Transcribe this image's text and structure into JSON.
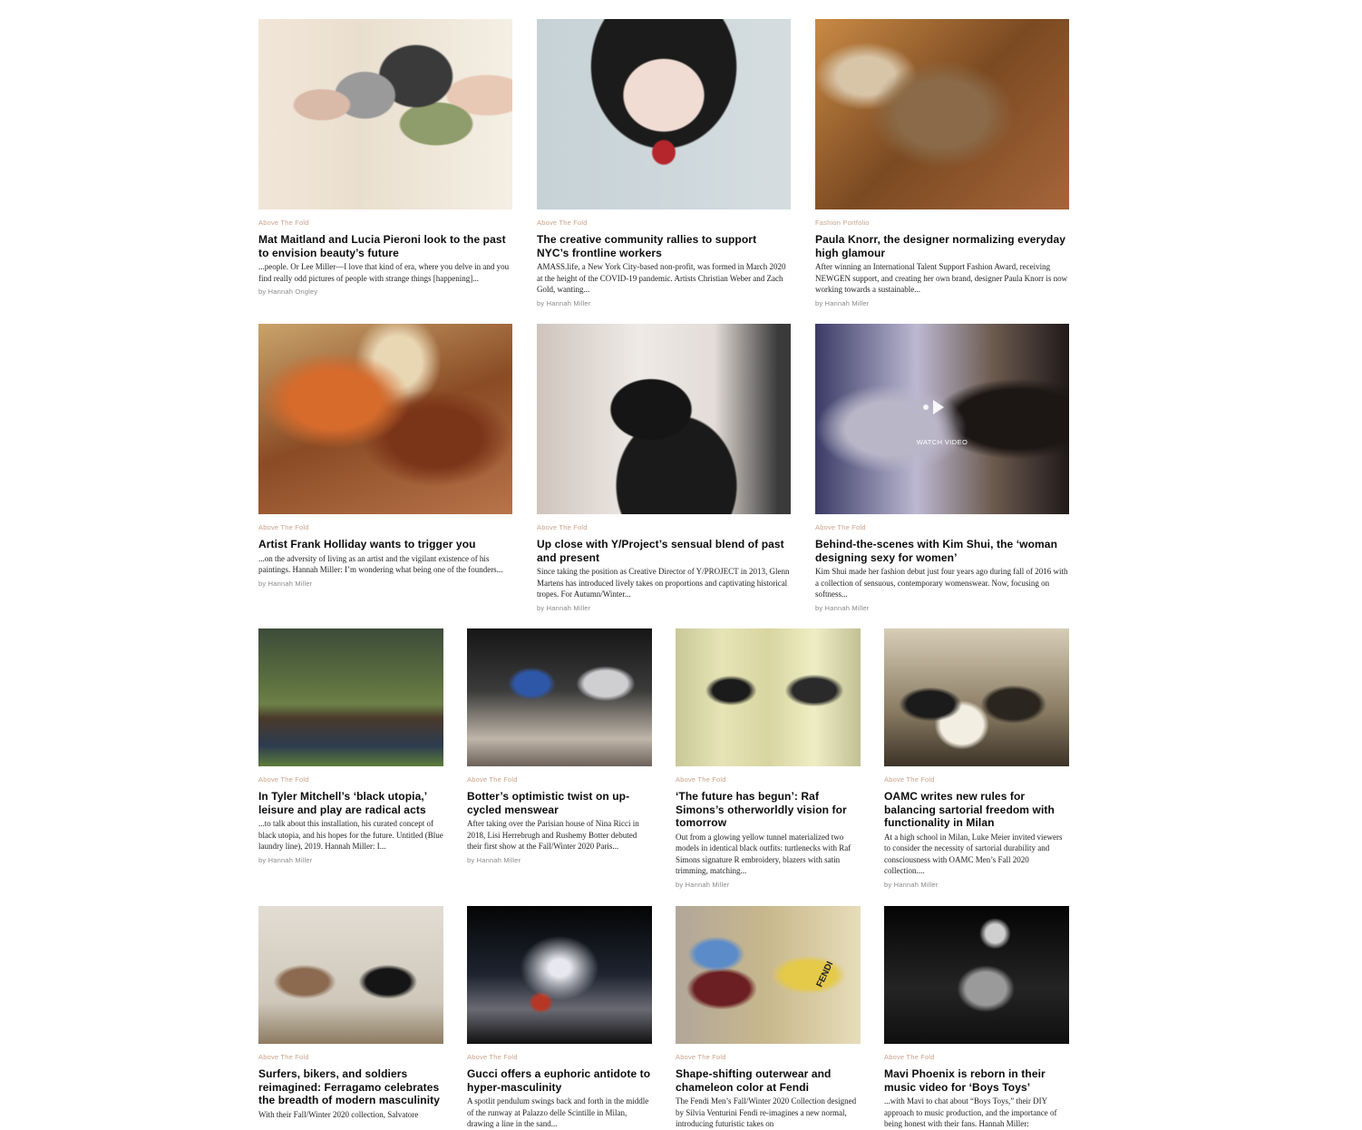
{
  "articles": [
    {
      "category": "Above The Fold",
      "title": "Mat Maitland and Lucia Pieroni look to the past to envision beauty’s future",
      "excerpt": "...people. Or Lee Miller—I love that kind of era, where you delve in and you find really odd pictures of people with strange things [happening]...",
      "author": "by Hannah Ongley"
    },
    {
      "category": "Above The Fold",
      "title": "The creative community rallies to support NYC’s frontline workers",
      "excerpt": "AMASS.life, a New York City-based non-profit, was formed in March 2020 at the height of the COVID-19 pandemic. Artists Christian Weber and Zach Gold, wanting...",
      "author": "by Hannah Miller"
    },
    {
      "category": "Fashion Portfolio",
      "title": "Paula Knorr, the designer normalizing everyday high glamour",
      "excerpt": "After winning an International Talent Support Fashion Award, receiving NEWGEN support, and creating her own brand, designer Paula Knorr is now working towards a sustainable...",
      "author": "by Hannah Miller"
    },
    {
      "category": "Above The Fold",
      "title": "Artist Frank Holliday wants to trigger you",
      "excerpt": "...on the adversity of living as an artist and the vigilant existence of his paintings. Hannah Miller: I’m wondering what being one of the founders...",
      "author": "by Hannah Miller"
    },
    {
      "category": "Above The Fold",
      "title": "Up close with Y/Project’s sensual blend of past and present",
      "excerpt": "Since taking the position as Creative Director of Y/PROJECT in 2013, Glenn Martens has introduced lively takes on proportions and captivating historical tropes. For Autumn/Winter...",
      "author": "by Hannah Miller"
    },
    {
      "category": "Above The Fold",
      "title": "Behind-the-scenes with Kim Shui, the ‘woman designing sexy for women’",
      "excerpt": "Kim Shui made her fashion debut just four years ago during fall of 2016 with a collection of sensuous, contemporary womenswear. Now, focusing on softness...",
      "author": "by Hannah Miller",
      "video_label": "WATCH VIDEO"
    },
    {
      "category": "Above The Fold",
      "title": "In Tyler Mitchell’s ‘black utopia,’ leisure and play are radical acts",
      "excerpt": "...to talk about this installation, his curated concept of black utopia, and his hopes for the future. Untitled (Blue laundry line), 2019. Hannah Miller: I...",
      "author": "by Hannah Miller"
    },
    {
      "category": "Above The Fold",
      "title": "Botter’s optimistic twist on up-cycled menswear",
      "excerpt": "After taking over the Parisian house of Nina Ricci in 2018, Lisi Herrebrugh and Rushemy Botter debuted their first show at the Fall/Winter 2020 Paris...",
      "author": "by Hannah Miller"
    },
    {
      "category": "Above The Fold",
      "title": "‘The future has begun’: Raf Simons’s otherworldly vision for tomorrow",
      "excerpt": "Out from a glowing yellow tunnel materialized two models in identical black outfits: turtlenecks with Raf Simons signature R embroidery, blazers with satin trimming, matching...",
      "author": "by Hannah Miller"
    },
    {
      "category": "Above The Fold",
      "title": "OAMC writes new rules for balancing sartorial freedom with functionality in Milan",
      "excerpt": "At a high school in Milan, Luke Meier invited viewers to consider the necessity of sartorial durability and consciousness with OAMC Men’s Fall 2020 collection....",
      "author": "by Hannah Miller"
    },
    {
      "category": "Above The Fold",
      "title": "Surfers, bikers, and soldiers reimagined: Ferragamo celebrates the breadth of modern masculinity",
      "excerpt": "With their Fall/Winter 2020 collection, Salvatore",
      "author": ""
    },
    {
      "category": "Above The Fold",
      "title": "Gucci offers a euphoric antidote to hyper-masculinity",
      "excerpt": "A spotlit pendulum swings back and forth in the middle of the runway at Palazzo delle Scintille in Milan, drawing a line in the sand...",
      "author": ""
    },
    {
      "category": "Above The Fold",
      "title": "Shape-shifting outerwear and chameleon color at Fendi",
      "excerpt": "The Fendi Men’s Fall/Winter 2020 Collection designed by Silvia Venturini Fendi re-imagines a new normal, introducing futuristic takes on",
      "author": "",
      "image_text": "FENDI"
    },
    {
      "category": "Above The Fold",
      "title": "Mavi Phoenix is reborn in their music video for ‘Boys Toys’",
      "excerpt": "...with Mavi to chat about “Boys Toys,” their DIY approach to music production, and the importance of being honest with their fans. Hannah Miller:",
      "author": ""
    }
  ]
}
